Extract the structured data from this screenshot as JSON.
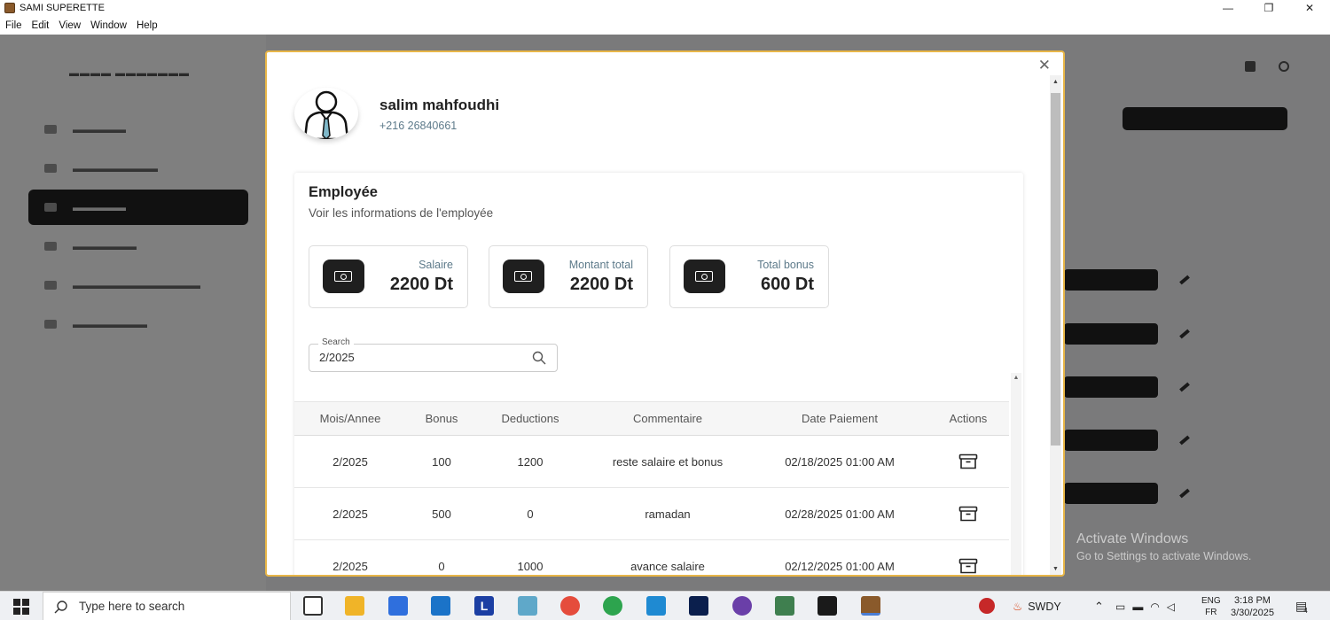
{
  "window": {
    "title": "SAMI SUPERETTE",
    "minimize": "—",
    "maximize": "❐",
    "close": "✕"
  },
  "menu": [
    "File",
    "Edit",
    "View",
    "Window",
    "Help"
  ],
  "employee": {
    "name": "salim mahfoudhi",
    "phone": "+216 26840661"
  },
  "card": {
    "title": "Employée",
    "subtitle": "Voir les informations de l'employée"
  },
  "stats": [
    {
      "label": "Salaire",
      "value": "2200 Dt",
      "icon": "money-bill-icon"
    },
    {
      "label": "Montant total",
      "value": "2200 Dt",
      "icon": "money-bill-icon"
    },
    {
      "label": "Total bonus",
      "value": "600 Dt",
      "icon": "money-bill-icon"
    }
  ],
  "search": {
    "label": "Search",
    "value": "2/2025"
  },
  "table": {
    "headers": [
      "Mois/Annee",
      "Bonus",
      "Deductions",
      "Commentaire",
      "Date Paiement",
      "Actions"
    ],
    "rows": [
      {
        "mois": "2/2025",
        "bonus": "100",
        "deductions": "1200",
        "commentaire": "reste salaire et bonus",
        "date": "02/18/2025 01:00 AM"
      },
      {
        "mois": "2/2025",
        "bonus": "500",
        "deductions": "0",
        "commentaire": "ramadan",
        "date": "02/28/2025 01:00 AM"
      },
      {
        "mois": "2/2025",
        "bonus": "0",
        "deductions": "1000",
        "commentaire": "avance salaire",
        "date": "02/12/2025 01:00 AM"
      }
    ]
  },
  "watermark": {
    "line1": "Activate Windows",
    "line2": "Go to Settings to activate Windows."
  },
  "taskbar": {
    "search_placeholder": "Type here to search",
    "tray_label": "SWDY",
    "lang_top": "ENG",
    "lang_bottom": "FR",
    "time": "3:18 PM",
    "date": "3/30/2025",
    "notif_count": "4"
  },
  "colors": {
    "modal_border": "#e8b648",
    "dark": "#1f1f1f",
    "muted_text": "#5d7a8a"
  }
}
